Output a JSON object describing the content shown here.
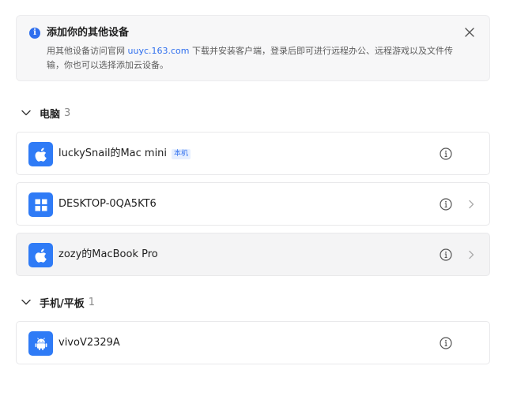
{
  "banner": {
    "icon": "info-icon",
    "title": "添加你的其他设备",
    "desc_prefix": "用其他设备访问官网 ",
    "link": "uuyc.163.com",
    "desc_suffix": " 下载并安装客户端，登录后即可进行远程办公、远程游戏以及文件传输，你也可以选择添加云设备。",
    "close_icon": "close-icon"
  },
  "sections": {
    "computers": {
      "name": "电脑",
      "count": "3"
    },
    "mobile": {
      "name": "手机/平板",
      "count": "1"
    }
  },
  "devices": [
    {
      "name": "luckySnail的Mac mini",
      "tag": "本机",
      "icon": "apple-icon"
    },
    {
      "name": "DESKTOP-0QA5KT6",
      "icon": "windows-icon"
    },
    {
      "name": "zozy的MacBook Pro",
      "icon": "apple-icon"
    },
    {
      "name": "vivoV2329A",
      "icon": "android-icon"
    }
  ],
  "colors": {
    "accent": "#2f6fee",
    "device_icon_bg": "#2f7bf6"
  }
}
